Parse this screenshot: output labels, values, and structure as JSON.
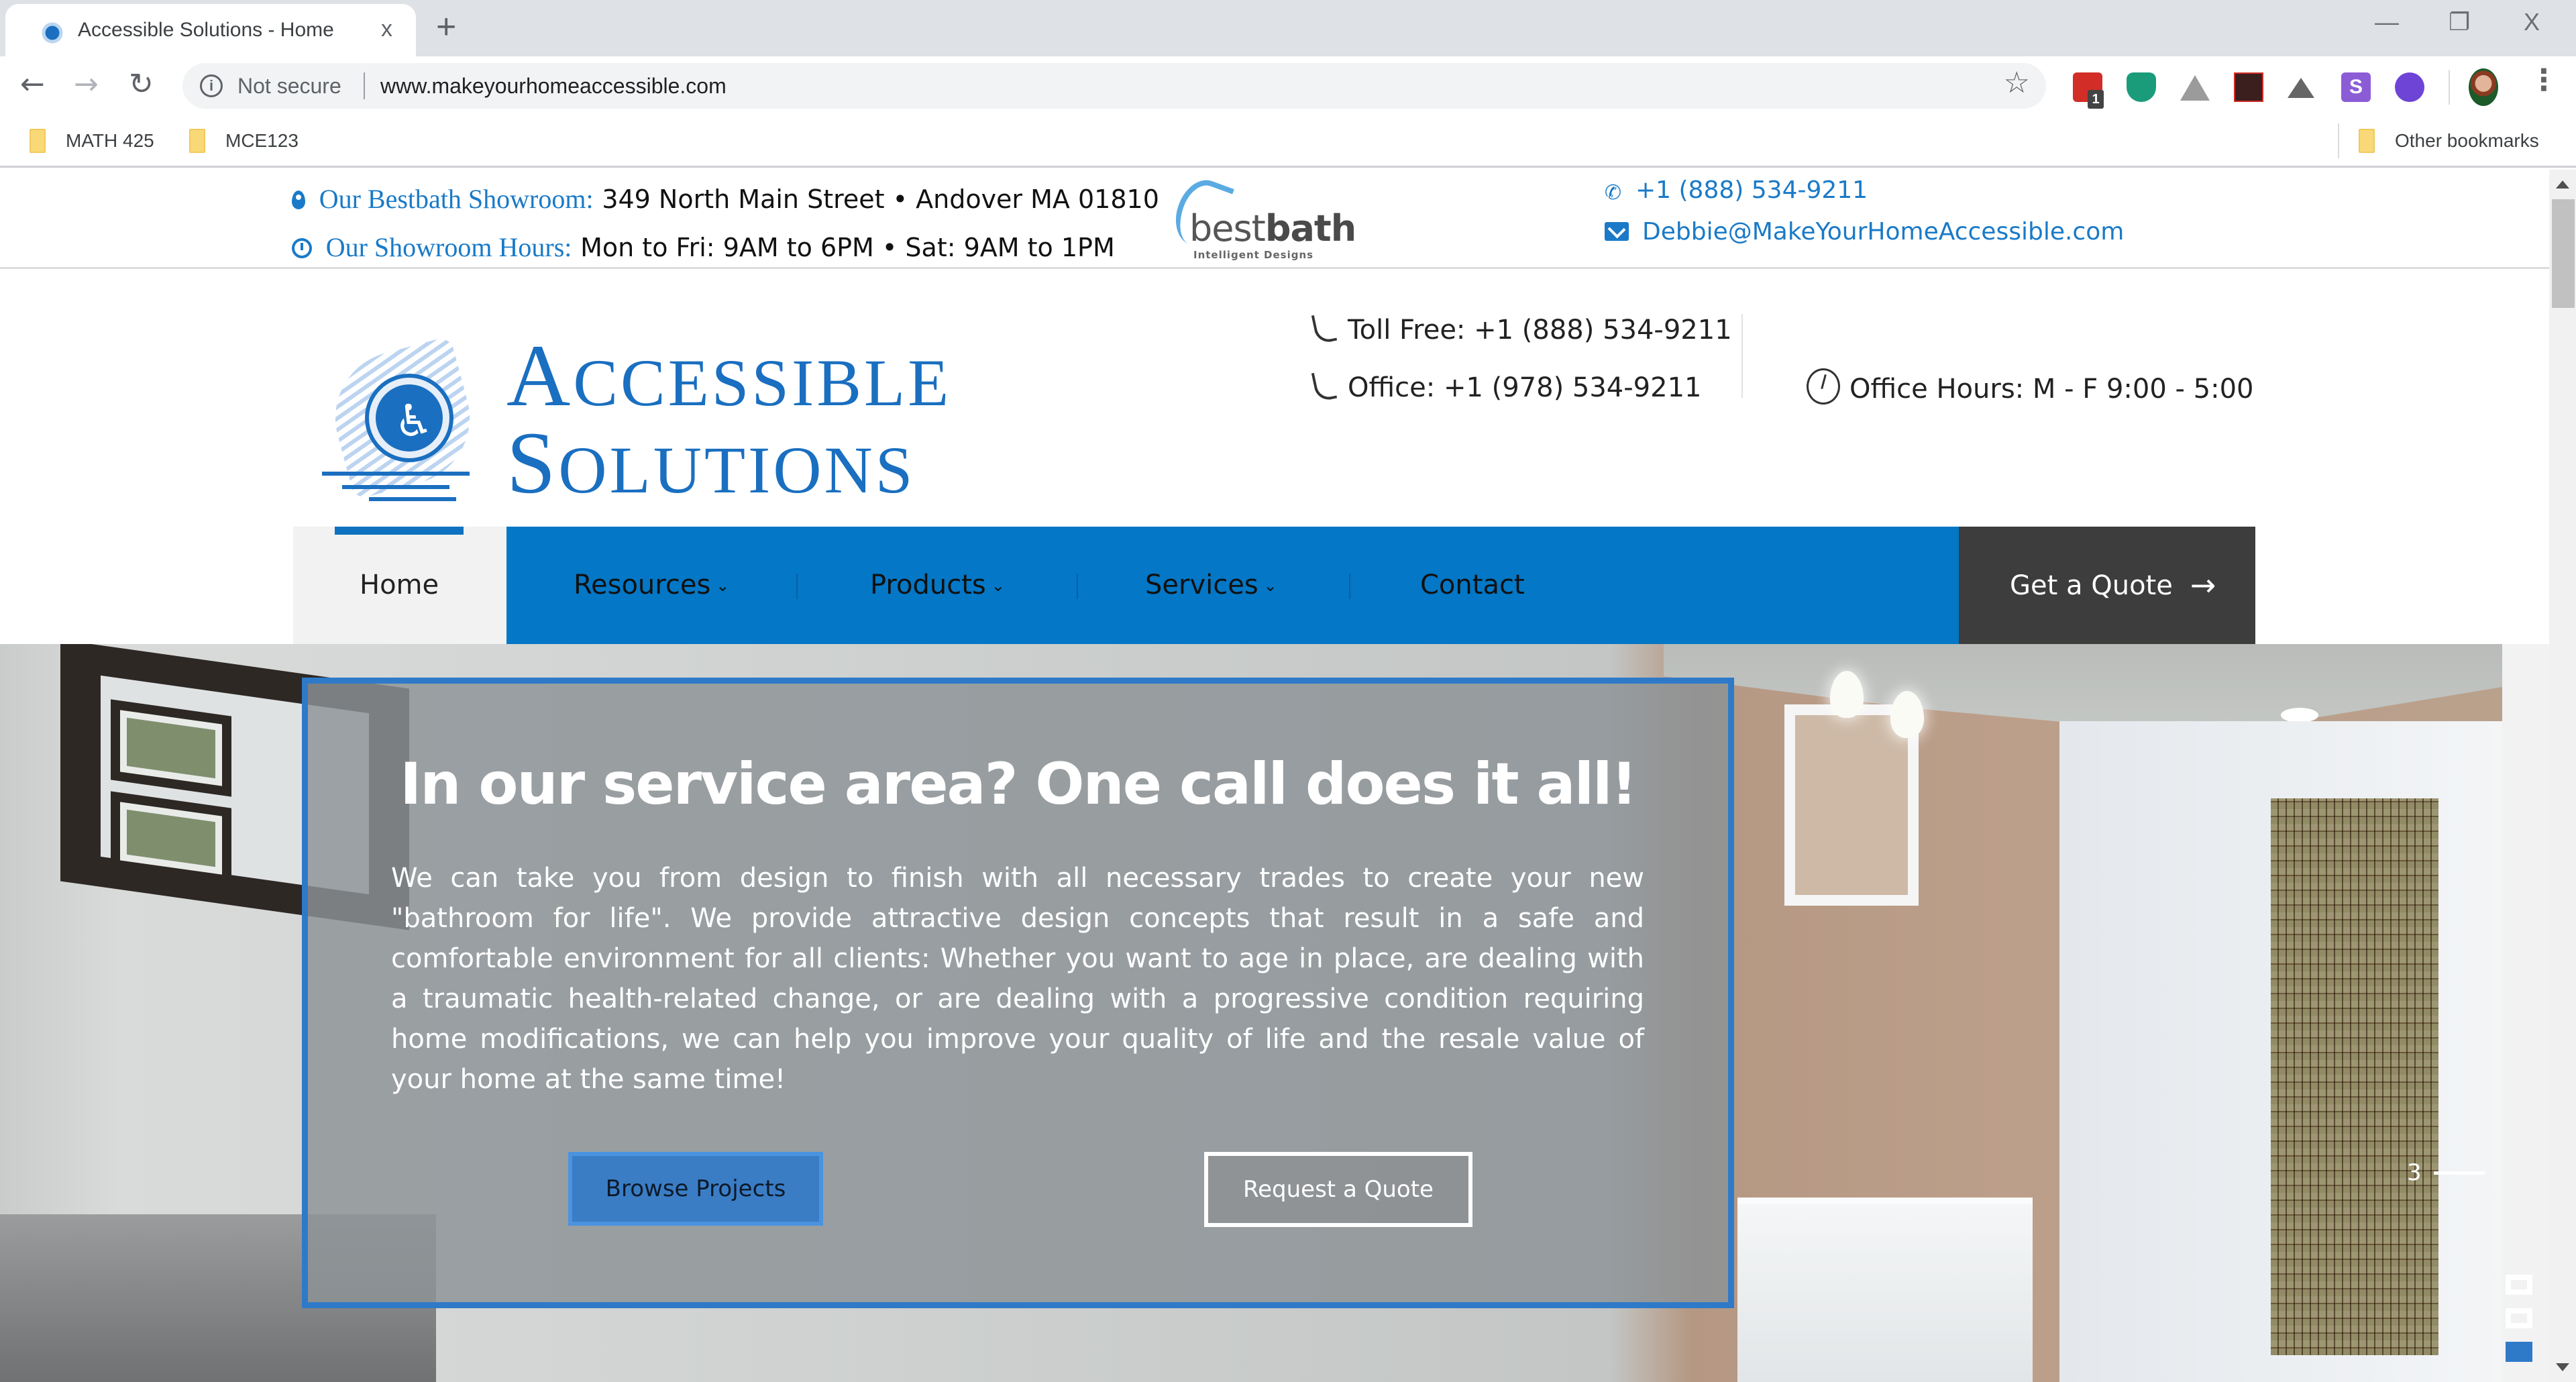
{
  "browser": {
    "tab_title": "Accessible Solutions - Home",
    "tab_close": "x",
    "new_tab": "+",
    "window_controls": {
      "minimize": "—",
      "restore": "❐",
      "close": "X"
    },
    "security_label": "Not secure",
    "url": "www.makeyourhomeaccessible.com",
    "extensions": [
      {
        "name": "lastpass",
        "color": "#d32d27",
        "badge": "1"
      },
      {
        "name": "shield-check",
        "color": "#1a9c7b"
      },
      {
        "name": "google-drive",
        "color": "#9b9b9b"
      },
      {
        "name": "adobe-acrobat",
        "color": "#3b1e1e"
      },
      {
        "name": "mountain-arrow",
        "color": "#666666"
      },
      {
        "name": "s-extension",
        "color": "#8c5cd6"
      },
      {
        "name": "circle-extension",
        "color": "#6d44d6"
      }
    ],
    "bookmarks": [
      {
        "label": "MATH 425"
      },
      {
        "label": "MCE123"
      }
    ],
    "other_bookmarks": "Other bookmarks"
  },
  "topbar": {
    "showroom_label": "Our Bestbath Showroom:",
    "showroom_address": "349 North Main Street • Andover MA 01810",
    "hours_label": "Our Showroom Hours:",
    "hours_value": "Mon to Fri: 9AM to 6PM • Sat: 9AM to 1PM",
    "partner_logo": {
      "name": "bestbath",
      "name_light": "best",
      "name_bold": "bath",
      "tagline": "Intelligent Designs"
    },
    "phone": "+1 (888) 534-9211",
    "email": "Debbie@MakeYourHomeAccessible.com"
  },
  "header": {
    "logo": {
      "line1_cap": "A",
      "line1_rest": "CCESSIBLE",
      "line2_cap": "S",
      "line2_rest": "OLUTIONS"
    },
    "toll_free": "Toll Free: +1 (888) 534-9211",
    "office": "Office: +1 (978) 534-9211",
    "office_hours": "Office Hours: M - F 9:00 - 5:00"
  },
  "nav": {
    "items": [
      {
        "label": "Home",
        "active": true,
        "dropdown": false
      },
      {
        "label": "Resources",
        "dropdown": true
      },
      {
        "label": "Products",
        "dropdown": true
      },
      {
        "label": "Services",
        "dropdown": true
      },
      {
        "label": "Contact",
        "dropdown": false
      }
    ],
    "cta": "Get a Quote",
    "chevron": "⌄",
    "arrow": "→"
  },
  "hero": {
    "title": "In our service area? One call does it all!",
    "body": "We can take you from design to finish with all necessary trades to create your new \"bathroom for life\". We provide attractive design concepts that result in a safe and comfortable environment for all clients: Whether you want to age in place, are dealing with a traumatic health-related change, or are dealing with a progressive condition requiring home modifications, we can help you improve your quality of life and the resale value of your home at the same time!",
    "primary_button": "Browse Projects",
    "secondary_button": "Request a Quote",
    "slider": {
      "current": "3",
      "total_slides": 3,
      "active_index": 2
    }
  },
  "colors": {
    "brand_blue": "#0477c6",
    "accent_blue": "#2f7ac8",
    "dark_cta": "#3d3d3d",
    "link_blue": "#1a7ac7"
  }
}
